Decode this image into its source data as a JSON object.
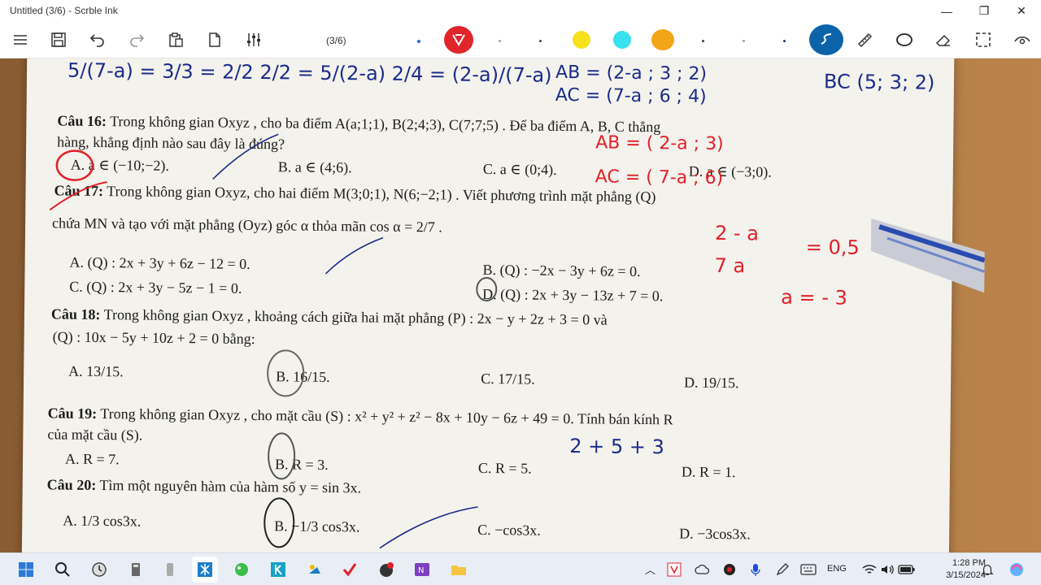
{
  "window": {
    "title": "Untitled (3/6) - Scrble Ink"
  },
  "toolbar": {
    "page_counter": "(3/6)"
  },
  "colors": {
    "pen_red": "#e0262b",
    "pen_yellow": "#f6e21b",
    "pen_cyan": "#39e0f0",
    "pen_orange": "#f3a417",
    "active_tool": "#0c63a8"
  },
  "document": {
    "handwriting": {
      "top_fraction": "5/(7-a) = 3/3 = 2/2   2/2 = 5/(2-a)   2/4 = (2-a)/(7-a)",
      "ab_ac_1": "AB = (2-a ; 3 ; 2)",
      "ab_ac_2": "AC = (7-a ; 6 ; 4)",
      "bc": "BC (5; 3; 2)",
      "red_ab": "AB = ( 2-a ; 3)",
      "red_ac": "AC = ( 7-a ; 6)",
      "red_frac_num": "2 - a",
      "red_frac_den": "7 a",
      "red_eq": "= 0,5",
      "red_result": "a = - 3",
      "sum": "2 + 5 + 3"
    },
    "q16": {
      "label": "Câu 16:",
      "text": "Trong không gian Oxyz , cho ba điểm A(a;1;1), B(2;4;3), C(7;7;5) . Để ba điểm A, B, C thẳng",
      "text2": "hàng, khẳng định nào sau đây là đúng?",
      "a": "A. a ∈ (−10;−2).",
      "b": "B. a ∈ (4;6).",
      "c": "C. a ∈ (0;4).",
      "d": "D. a ∈ (−3;0)."
    },
    "q17": {
      "label": "Câu 17:",
      "text": "Trong không gian Oxyz, cho hai điểm M(3;0;1), N(6;−2;1) . Viết phương trình mặt phẳng (Q)",
      "text2": "chứa MN và tạo với mặt phẳng (Oyz) góc α thỏa mãn cos α = 2/7 .",
      "a": "A. (Q) : 2x + 3y + 6z − 12 = 0.",
      "b": "B. (Q) : −2x − 3y + 6z = 0.",
      "c": "C. (Q) : 2x + 3y − 5z − 1 = 0.",
      "d": "D. (Q) : 2x + 3y − 13z + 7 = 0."
    },
    "q18": {
      "label": "Câu 18:",
      "text": "Trong không gian Oxyz , khoảng cách giữa hai mặt phẳng (P) : 2x − y + 2z + 3 = 0 và",
      "text2": "(Q) : 10x − 5y + 10z + 2 = 0 bằng:",
      "a": "A. 13/15.",
      "b": "B. 16/15.",
      "c": "C. 17/15.",
      "d": "D. 19/15."
    },
    "q19": {
      "label": "Câu 19:",
      "text": "Trong không gian Oxyz , cho mặt cầu (S) : x² + y² + z² − 8x + 10y − 6z + 49 = 0. Tính bán kính R",
      "text2": "của mặt cầu (S).",
      "a": "A. R = 7.",
      "b": "B. R = 3.",
      "c": "C. R = 5.",
      "d": "D. R = 1."
    },
    "q20": {
      "label": "Câu 20:",
      "text": "Tìm một nguyên hàm của hàm số y = sin 3x.",
      "a": "A. 1/3 cos3x.",
      "b": "B. −1/3 cos3x.",
      "c": "C. −cos3x.",
      "d": "D. −3cos3x."
    }
  },
  "taskbar": {
    "lang": "ENG",
    "time": "1:28 PM",
    "date": "3/15/2024"
  }
}
